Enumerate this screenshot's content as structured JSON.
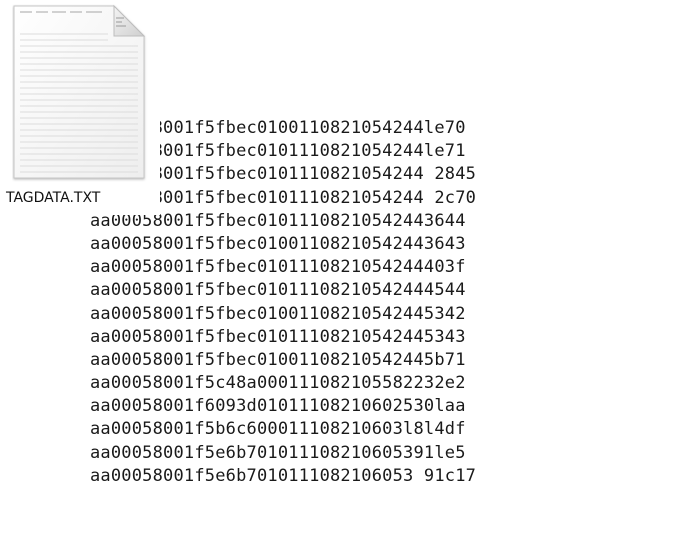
{
  "file": {
    "name": "TAGDATA.TXT",
    "icon": "text-file-icon"
  },
  "lines": [
    "aa00058001f5fbec0100110821054244le70",
    "aa00058001f5fbec0101110821054244le71",
    "aa00058001f5fbec0101110821054244 2845",
    "aa00058001f5fbec0101110821054244 2c70",
    "aa00058001f5fbec01011108210542443644",
    "aa00058001f5fbec01001108210542443643",
    "aa00058001f5fbec0101110821054244403f",
    "aa00058001f5fbec01011108210542444544",
    "aa00058001f5fbec01001108210542445342",
    "aa00058001f5fbec01011108210542445343",
    "aa00058001f5fbec01001108210542445b71",
    "aa00058001f5c48a000111082105582232e2",
    "aa00058001f6093d01011108210602530laa",
    "aa00058001f5b6c600011108210603l8l4df",
    "aa00058001f5e6b701011108210605391le5",
    "aa00058001f5e6b7010111082106053 91c17"
  ]
}
